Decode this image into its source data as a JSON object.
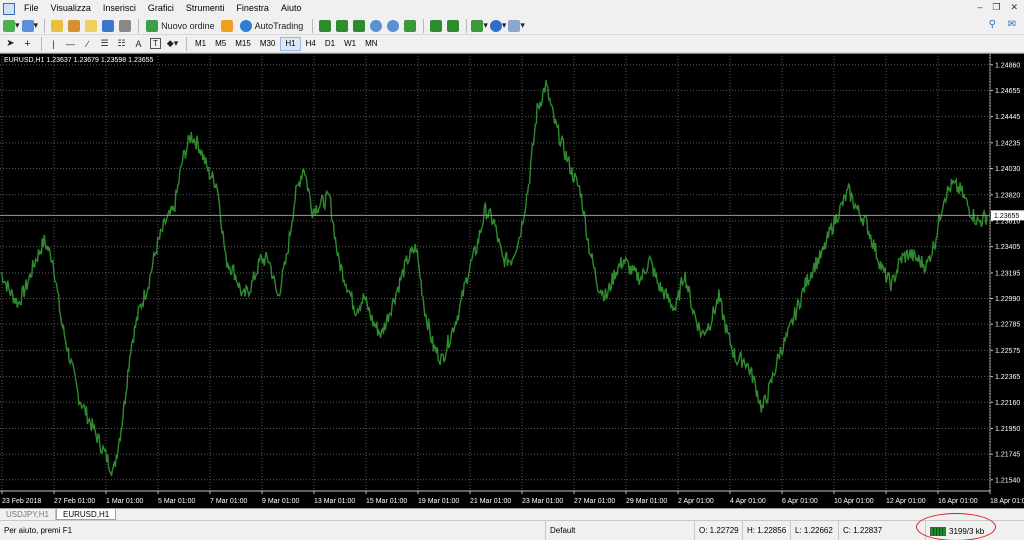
{
  "menu": [
    "File",
    "Visualizza",
    "Inserisci",
    "Grafici",
    "Strumenti",
    "Finestra",
    "Aiuto"
  ],
  "toolbar1": {
    "new_order_label": "Nuovo ordine",
    "autotrading_label": "AutoTrading"
  },
  "toolbar2": {
    "text_tool_label": "A",
    "timeframes": [
      "M1",
      "M5",
      "M15",
      "M30",
      "H1",
      "H4",
      "D1",
      "W1",
      "MN"
    ],
    "active_timeframe": "H1"
  },
  "chart": {
    "info": "EURUSD,H1  1.23637 1.23679 1.23598 1.23655",
    "current_price_label": "1.23655"
  },
  "chart_data": {
    "type": "line",
    "symbol": "EURUSD",
    "timeframe": "H1",
    "ylim": [
      1.2145,
      1.2493
    ],
    "yticks": [
      "1.24860",
      "1.24655",
      "1.24445",
      "1.24235",
      "1.24030",
      "1.23820",
      "1.23610",
      "1.23405",
      "1.23195",
      "1.22990",
      "1.22785",
      "1.22575",
      "1.22365",
      "1.22160",
      "1.21950",
      "1.21745",
      "1.21540"
    ],
    "xticks": [
      "23 Feb 2018",
      "27 Feb 01:00",
      "1 Mar 01:00",
      "5 Mar 01:00",
      "7 Mar 01:00",
      "9 Mar 01:00",
      "13 Mar 01:00",
      "15 Mar 01:00",
      "19 Mar 01:00",
      "21 Mar 01:00",
      "23 Mar 01:00",
      "27 Mar 01:00",
      "29 Mar 01:00",
      "2 Apr 01:00",
      "4 Apr 01:00",
      "6 Apr 01:00",
      "10 Apr 01:00",
      "12 Apr 01:00",
      "16 Apr 01:00",
      "18 Apr 01:00"
    ],
    "current_price": 1.23655,
    "grid": true,
    "line_color": "#2e8b2e",
    "background": "#000000",
    "series": [
      {
        "values": [
          1.232,
          1.2305,
          1.2295,
          1.231,
          1.233,
          1.2345,
          1.233,
          1.228,
          1.225,
          1.222,
          1.2205,
          1.219,
          1.2175,
          1.216,
          1.22,
          1.226,
          1.229,
          1.231,
          1.234,
          1.236,
          1.237,
          1.241,
          1.243,
          1.242,
          1.24,
          1.239,
          1.233,
          1.232,
          1.23,
          1.231,
          1.233,
          1.233,
          1.23,
          1.233,
          1.238,
          1.2405,
          1.237,
          1.2375,
          1.238,
          1.233,
          1.231,
          1.229,
          1.23,
          1.228,
          1.227,
          1.229,
          1.231,
          1.233,
          1.234,
          1.229,
          1.226,
          1.225,
          1.227,
          1.229,
          1.232,
          1.234,
          1.237,
          1.236,
          1.233,
          1.233,
          1.235,
          1.239,
          1.245,
          1.247,
          1.244,
          1.242,
          1.24,
          1.2385,
          1.234,
          1.231,
          1.23,
          1.232,
          1.233,
          1.232,
          1.2315,
          1.233,
          1.231,
          1.23,
          1.229,
          1.232,
          1.229,
          1.227,
          1.228,
          1.23,
          1.227,
          1.225,
          1.225,
          1.2235,
          1.221,
          1.223,
          1.2255,
          1.227,
          1.229,
          1.231,
          1.2325,
          1.2335,
          1.2355,
          1.237,
          1.2385,
          1.237,
          1.236,
          1.234,
          1.232,
          1.231,
          1.233,
          1.2335,
          1.233,
          1.2325,
          1.2345,
          1.238,
          1.239,
          1.2385,
          1.237,
          1.236,
          1.2365
        ]
      }
    ]
  },
  "tabs": [
    "USDJPY,H1",
    "EURUSD,H1"
  ],
  "active_tab": "EURUSD,H1",
  "status": {
    "help": "Per aiuto, premi F1",
    "profile": "Default",
    "open": "O: 1.22729",
    "high": "H: 1.22856",
    "low": "L: 1.22662",
    "close": "C: 1.22837",
    "traffic": "3199/3 kb"
  },
  "colors": {
    "highlight_circle": "#d42020"
  },
  "icons": [
    "new-chart-icon",
    "profiles-icon",
    "market-watch-icon",
    "navigator-icon",
    "data-window-icon",
    "terminal-icon",
    "strategy-tester-icon",
    "new-order-icon",
    "metaeditor-icon",
    "autotrading-icon",
    "bar-chart-icon",
    "candlestick-icon",
    "line-chart-icon",
    "zoom-in-icon",
    "zoom-out-icon",
    "tile-windows-icon",
    "auto-scroll-icon",
    "chart-shift-icon",
    "indicators-icon",
    "periods-icon",
    "templates-icon",
    "search-icon",
    "chat-icon",
    "cursor-icon",
    "crosshair-icon",
    "vertical-line-icon",
    "horizontal-line-icon",
    "trendline-icon",
    "channel-icon",
    "fibonacci-icon",
    "text-label-icon",
    "shapes-icon"
  ]
}
